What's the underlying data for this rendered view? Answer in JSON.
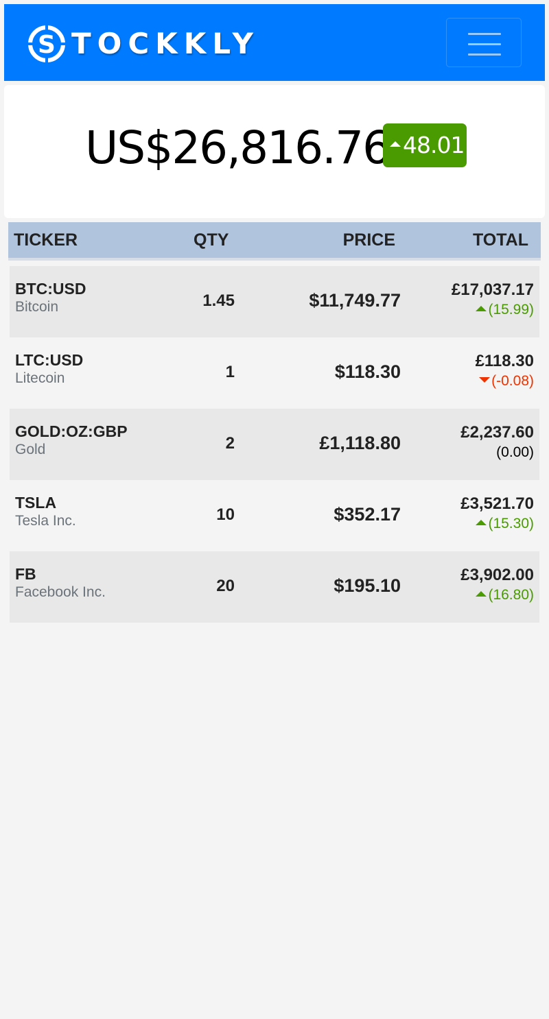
{
  "app": {
    "brand_name": "TOCKKLY",
    "logo_letter": "S",
    "colors": {
      "navbar": "#007bff",
      "up": "#4a9a02",
      "down": "#ee3300",
      "table_header": "#b0c4de"
    },
    "menu_icon": "hamburger-icon"
  },
  "summary": {
    "total_value": "US$26,816.76",
    "change": "48.01",
    "direction": "up"
  },
  "table": {
    "headers": {
      "ticker": "TICKER",
      "qty": "QTY",
      "price": "PRICE",
      "total": "TOTAL"
    },
    "rows": [
      {
        "symbol": "BTC:USD",
        "name": "Bitcoin",
        "qty": "1.45",
        "price": "$11,749.77",
        "total": "£17,037.17",
        "change": "(15.99)",
        "direction": "up"
      },
      {
        "symbol": "LTC:USD",
        "name": "Litecoin",
        "qty": "1",
        "price": "$118.30",
        "total": "£118.30",
        "change": "(-0.08)",
        "direction": "down"
      },
      {
        "symbol": "GOLD:OZ:GBP",
        "name": "Gold",
        "qty": "2",
        "price": "£1,118.80",
        "total": "£2,237.60",
        "change": "(0.00)",
        "direction": "flat"
      },
      {
        "symbol": "TSLA",
        "name": "Tesla Inc.",
        "qty": "10",
        "price": "$352.17",
        "total": "£3,521.70",
        "change": "(15.30)",
        "direction": "up"
      },
      {
        "symbol": "FB",
        "name": "Facebook Inc.",
        "qty": "20",
        "price": "$195.10",
        "total": "£3,902.00",
        "change": "(16.80)",
        "direction": "up"
      }
    ]
  }
}
